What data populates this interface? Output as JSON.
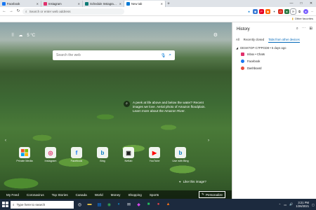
{
  "tabs": [
    {
      "label": "Facebook",
      "color": "#1877f2",
      "active": false
    },
    {
      "label": "Instagram",
      "color": "#e1306c",
      "active": false
    },
    {
      "label": "Schedule Instagram Posts Free",
      "color": "#0b7a75",
      "active": false
    },
    {
      "label": "New tab",
      "color": "#0078d4",
      "active": true
    }
  ],
  "toolbar": {
    "address_placeholder": "Search or enter web address",
    "extension_icons": [
      "star-icon",
      "shield-icon",
      "pinterest-icon",
      "shopping-icon",
      "puzzle-icon",
      "opera-icon",
      "circle-icon",
      "history-icon",
      "collections-icon",
      "profile-icon",
      "more-icon"
    ]
  },
  "favorites": {
    "other_label": "Other favorites"
  },
  "newtab": {
    "temperature": "5 °C",
    "search_placeholder": "Search the web",
    "info_text": "A peek at life above and below the water? Recent images we love. Aerial photo of Amazon floodplain. Learn more about the Amazon River.",
    "quick_links": [
      {
        "label": "Private Media",
        "glyph": "▦",
        "color": "#f25022"
      },
      {
        "label": "Instagram",
        "glyph": "◎",
        "color": "#e1306c"
      },
      {
        "label": "Facebook",
        "glyph": "f",
        "color": "#1877f2"
      },
      {
        "label": "Bing",
        "glyph": "b",
        "color": "#0a7ec2"
      },
      {
        "label": "Netlab",
        "glyph": "▣",
        "color": "#222222"
      },
      {
        "label": "YouTube",
        "glyph": "▶",
        "color": "#ff0000"
      },
      {
        "label": "Use with Bing",
        "glyph": "b",
        "color": "#0a7ec2"
      }
    ],
    "like_image": "Like this image?",
    "feed_items": [
      "My Feed",
      "Coronavirus",
      "Top Stories",
      "Canada",
      "World",
      "Money",
      "Shopping",
      "Sports"
    ],
    "personalize": "Personalize"
  },
  "history": {
    "title": "History",
    "tabs": [
      "All",
      "Recently closed",
      "Tabs from other devices"
    ],
    "device": "DESKTOP-C7PPGD8 • 5 days ago",
    "items": [
      {
        "label": "Inbox • Chats",
        "color": "#e1306c"
      },
      {
        "label": "Facebook",
        "color": "#1877f2"
      },
      {
        "label": "Dashboard",
        "color": "#e74c3c"
      }
    ]
  },
  "taskbar": {
    "search_placeholder": "Type here to search",
    "time": "3:21 PM",
    "date": "1/26/2021"
  }
}
